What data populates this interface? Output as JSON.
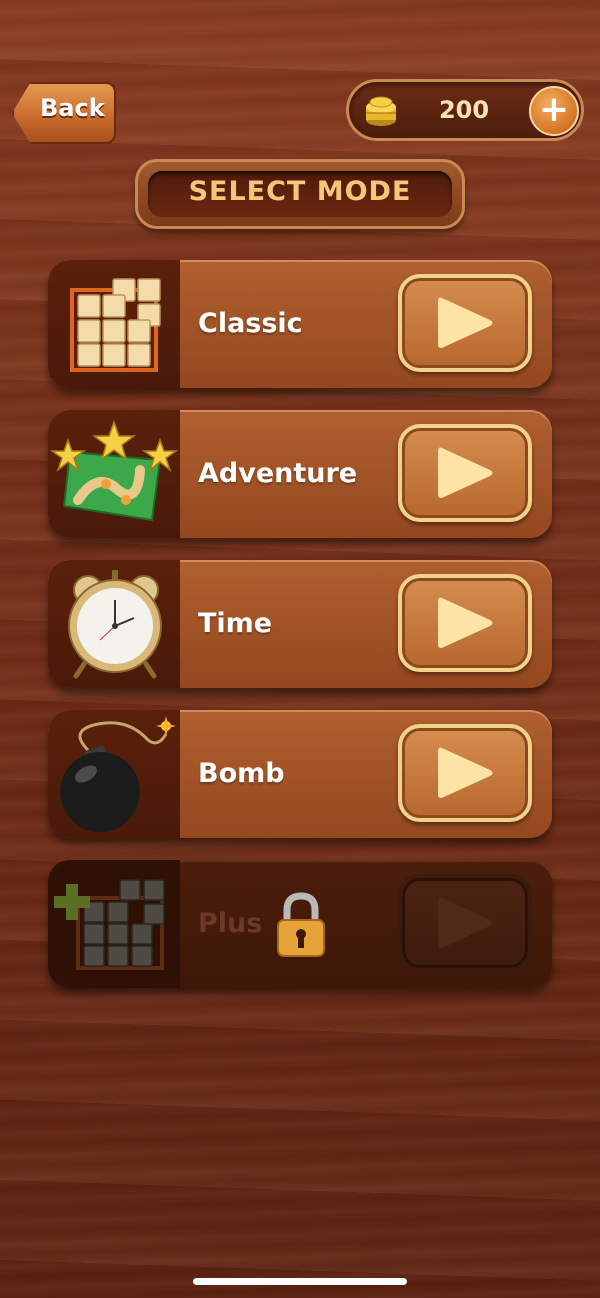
{
  "header": {
    "back_label": "Back",
    "coins": "200",
    "add_coins": "+"
  },
  "title": "SELECT MODE",
  "modes": [
    {
      "label": "Classic",
      "icon": "classic-blocks-icon",
      "locked": false
    },
    {
      "label": "Adventure",
      "icon": "adventure-map-stars-icon",
      "locked": false
    },
    {
      "label": "Time",
      "icon": "alarm-clock-icon",
      "locked": false
    },
    {
      "label": "Bomb",
      "icon": "bomb-icon",
      "locked": false
    },
    {
      "label": "Plus",
      "icon": "plus-blocks-icon",
      "locked": true
    }
  ],
  "colors": {
    "accent": "#c8692b",
    "gold": "#f2d28a",
    "title_text": "#f6c57c"
  }
}
